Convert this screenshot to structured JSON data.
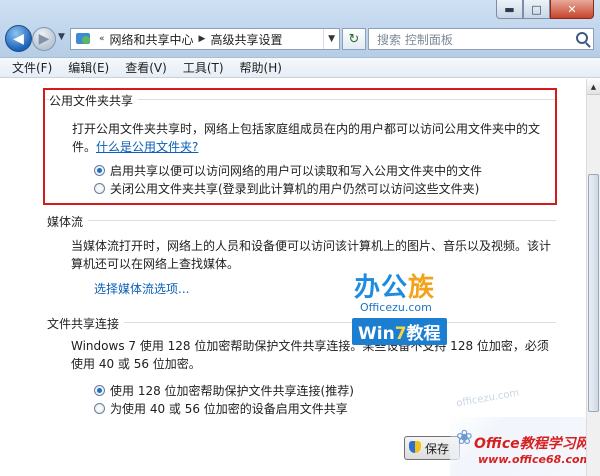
{
  "window": {
    "caption_buttons": {
      "minimize": "▬",
      "maximize": "□",
      "close": "✕"
    }
  },
  "nav": {
    "back_icon": "arrow-left-icon",
    "forward_icon": "arrow-right-icon",
    "dropdown_icon": "chevron-down-icon"
  },
  "address_bar": {
    "overflow": "«",
    "crumbs": [
      "网络和共享中心",
      "高级共享设置"
    ],
    "separator": "▶",
    "dropdown": "▼"
  },
  "refresh_label": "↻",
  "search": {
    "placeholder": "搜索 控制面板"
  },
  "menu": [
    "文件(F)",
    "编辑(E)",
    "查看(V)",
    "工具(T)",
    "帮助(H)"
  ],
  "public_folder": {
    "title": "公用文件夹共享",
    "description": "打开公用文件夹共享时，网络上包括家庭组成员在内的用户都可以访问公用文件夹中的文件。",
    "link": "什么是公用文件夹?",
    "options": [
      {
        "label": "启用共享以便可以访问网络的用户可以读取和写入公用文件夹中的文件",
        "checked": true
      },
      {
        "label": "关闭公用文件夹共享(登录到此计算机的用户仍然可以访问这些文件夹)",
        "checked": false
      }
    ]
  },
  "media_streaming": {
    "title": "媒体流",
    "description": "当媒体流打开时，网络上的人员和设备便可以访问该计算机上的图片、音乐以及视频。该计算机还可以在网络上查找媒体。",
    "link": "选择媒体流选项..."
  },
  "file_sharing": {
    "title": "文件共享连接",
    "description": "Windows 7 使用 128 位加密帮助保护文件共享连接。某些设备不支持 128 位加密，必须使用 40 或 56 位加密。",
    "options": [
      {
        "label": "使用 128 位加密帮助保护文件共享连接(推荐)",
        "checked": true
      },
      {
        "label": "为使用 40 或 56 位加密的设备启用文件共享",
        "checked": false
      }
    ]
  },
  "save_button": {
    "label": "保存",
    "icon": "shield-icon"
  },
  "watermarks": {
    "logo_text_a": "办公",
    "logo_text_b": "族",
    "logo_sub": "Officezu.com",
    "badge_a": "Win",
    "badge_b": "7",
    "badge_c": "教程",
    "faint_url": "officezu.com",
    "corner_title": "Office教程学习网",
    "corner_url": "www.office68.com"
  }
}
